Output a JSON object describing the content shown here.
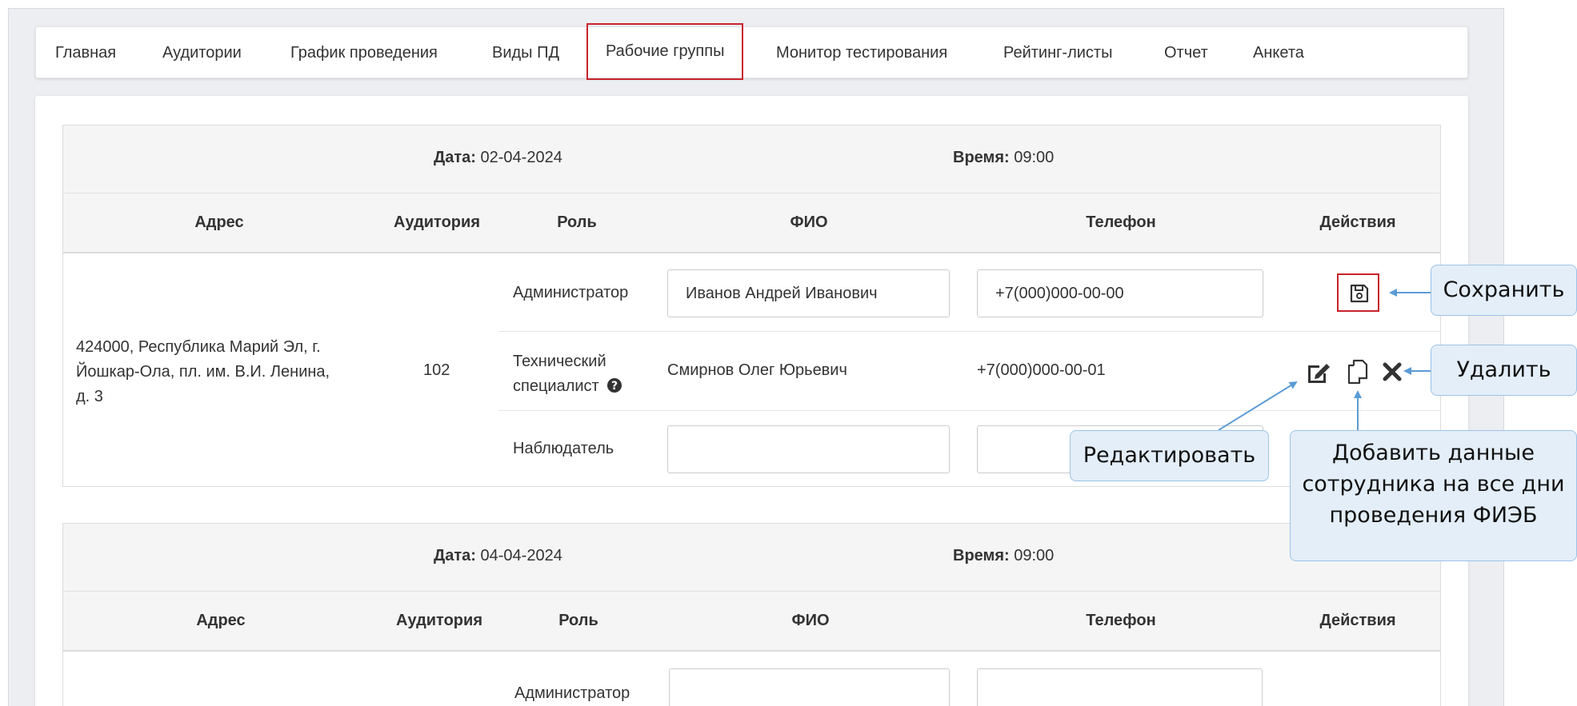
{
  "nav": {
    "items": [
      {
        "label": "Главная"
      },
      {
        "label": "Аудитории"
      },
      {
        "label": "График проведения"
      },
      {
        "label": "Виды ПД"
      },
      {
        "label": "Рабочие группы",
        "active": true
      },
      {
        "label": "Монитор тестирования"
      },
      {
        "label": "Рейтинг-листы"
      },
      {
        "label": "Отчет"
      },
      {
        "label": "Анкета"
      }
    ]
  },
  "columns": {
    "address": "Адрес",
    "room": "Аудитория",
    "role": "Роль",
    "fio": "ФИО",
    "phone": "Телефон",
    "actions": "Действия"
  },
  "blocks": [
    {
      "date_label": "Дата:",
      "date_value": "02-04-2024",
      "time_label": "Время:",
      "time_value": "09:00",
      "address": [
        "424000, Республика Марий Эл, г.",
        "Йошкар-Ола, пл. им. В.И. Ленина,",
        "д. 3"
      ],
      "room": "102",
      "rows": [
        {
          "role": "Администратор",
          "fio": "Иванов Андрей Иванович",
          "phone": "+7(000)000-00-00"
        },
        {
          "role_line1": "Технический",
          "role_line2": "специалист",
          "fio": "Смирнов Олег Юрьевич",
          "phone": "+7(000)000-00-01"
        },
        {
          "role": "Наблюдатель",
          "fio": "",
          "phone": ""
        }
      ]
    },
    {
      "date_label": "Дата:",
      "date_value": "04-04-2024",
      "time_label": "Время:",
      "time_value": "09:00",
      "rows": [
        {
          "role": "Администратор",
          "fio": "",
          "phone": ""
        }
      ]
    }
  ],
  "callouts": {
    "save": "Сохранить",
    "delete": "Удалить",
    "edit": "Редактировать",
    "copy_line1": "Добавить данные",
    "copy_line2": "сотрудника на все дни",
    "copy_line3": "проведения ФИЭБ"
  },
  "icons": {
    "save": "floppy-disk-icon",
    "edit": "edit-icon",
    "copy": "copy-icon",
    "delete": "close-icon",
    "help": "question-circle-icon"
  },
  "colors": {
    "highlight": "#c8232c",
    "callout_bg": "#e4eef9",
    "callout_border": "#9cc3e6",
    "arrow": "#5b9bd5",
    "header_bg": "#f5f5f5"
  }
}
